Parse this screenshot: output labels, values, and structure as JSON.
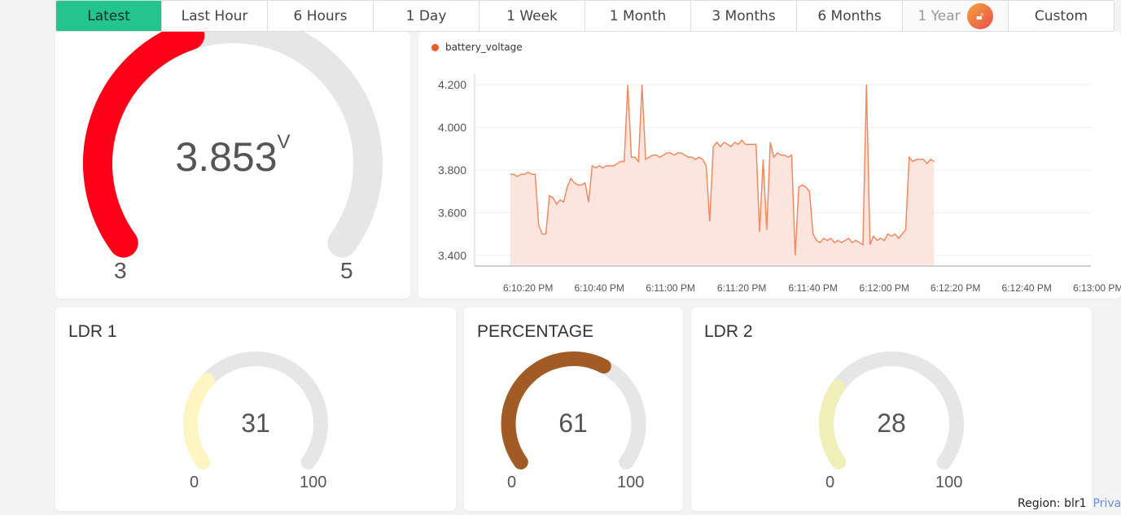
{
  "timebar": {
    "items": [
      {
        "label": "Latest",
        "active": true
      },
      {
        "label": "Last Hour"
      },
      {
        "label": "6 Hours"
      },
      {
        "label": "1 Day"
      },
      {
        "label": "1 Week"
      },
      {
        "label": "1 Month"
      },
      {
        "label": "3 Months"
      },
      {
        "label": "6 Months"
      },
      {
        "label": "1 Year",
        "locked": true,
        "icon": "lock-icon"
      },
      {
        "label": "Custom"
      }
    ]
  },
  "battery_gauge": {
    "value": "3.853",
    "unit": "V",
    "min": "3",
    "max": "5",
    "color": "#ff0019"
  },
  "chart_data": {
    "type": "area",
    "legend": "battery_voltage",
    "series_color": "#f28a5d",
    "fill_color": "#fde5df",
    "ylim": [
      3.35,
      4.25
    ],
    "yticks": [
      "4.200",
      "4.000",
      "3.800",
      "3.600",
      "3.400"
    ],
    "ytick_values": [
      4.2,
      4.0,
      3.8,
      3.6,
      3.4
    ],
    "xticks": [
      "6:10:20 PM",
      "6:10:40 PM",
      "6:11:00 PM",
      "6:11:20 PM",
      "6:11:40 PM",
      "6:12:00 PM",
      "6:12:20 PM",
      "6:12:40 PM",
      "6:13:00 PM"
    ],
    "x_seconds_start": 5,
    "x_seconds_end": 178,
    "points": [
      [
        15,
        3.78
      ],
      [
        16,
        3.78
      ],
      [
        17,
        3.77
      ],
      [
        18,
        3.78
      ],
      [
        19,
        3.78
      ],
      [
        20,
        3.79
      ],
      [
        21,
        3.78
      ],
      [
        22,
        3.78
      ],
      [
        23,
        3.54
      ],
      [
        24,
        3.5
      ],
      [
        25,
        3.5
      ],
      [
        26,
        3.68
      ],
      [
        27,
        3.67
      ],
      [
        28,
        3.64
      ],
      [
        29,
        3.66
      ],
      [
        30,
        3.65
      ],
      [
        31,
        3.72
      ],
      [
        32,
        3.76
      ],
      [
        33,
        3.74
      ],
      [
        34,
        3.73
      ],
      [
        35,
        3.73
      ],
      [
        36,
        3.74
      ],
      [
        37,
        3.65
      ],
      [
        38,
        3.82
      ],
      [
        39,
        3.81
      ],
      [
        40,
        3.82
      ],
      [
        41,
        3.81
      ],
      [
        42,
        3.82
      ],
      [
        43,
        3.82
      ],
      [
        44,
        3.82
      ],
      [
        45,
        3.83
      ],
      [
        46,
        3.84
      ],
      [
        47,
        3.84
      ],
      [
        48,
        4.2
      ],
      [
        49,
        3.86
      ],
      [
        50,
        3.86
      ],
      [
        51,
        3.84
      ],
      [
        52,
        4.2
      ],
      [
        53,
        3.85
      ],
      [
        54,
        3.86
      ],
      [
        55,
        3.87
      ],
      [
        56,
        3.87
      ],
      [
        57,
        3.86
      ],
      [
        58,
        3.87
      ],
      [
        59,
        3.88
      ],
      [
        60,
        3.88
      ],
      [
        61,
        3.87
      ],
      [
        62,
        3.88
      ],
      [
        63,
        3.88
      ],
      [
        64,
        3.87
      ],
      [
        65,
        3.86
      ],
      [
        66,
        3.86
      ],
      [
        67,
        3.85
      ],
      [
        68,
        3.86
      ],
      [
        69,
        3.85
      ],
      [
        70,
        3.82
      ],
      [
        71,
        3.56
      ],
      [
        72,
        3.91
      ],
      [
        73,
        3.93
      ],
      [
        74,
        3.91
      ],
      [
        75,
        3.93
      ],
      [
        76,
        3.92
      ],
      [
        77,
        3.91
      ],
      [
        78,
        3.93
      ],
      [
        79,
        3.92
      ],
      [
        80,
        3.94
      ],
      [
        81,
        3.92
      ],
      [
        82,
        3.92
      ],
      [
        83,
        3.92
      ],
      [
        84,
        3.92
      ],
      [
        85,
        3.51
      ],
      [
        86,
        3.85
      ],
      [
        87,
        3.52
      ],
      [
        88,
        3.93
      ],
      [
        89,
        3.86
      ],
      [
        90,
        3.88
      ],
      [
        91,
        3.87
      ],
      [
        92,
        3.87
      ],
      [
        93,
        3.86
      ],
      [
        94,
        3.87
      ],
      [
        95,
        3.4
      ],
      [
        96,
        3.72
      ],
      [
        97,
        3.73
      ],
      [
        98,
        3.72
      ],
      [
        99,
        3.7
      ],
      [
        100,
        3.5
      ],
      [
        101,
        3.47
      ],
      [
        102,
        3.46
      ],
      [
        103,
        3.48
      ],
      [
        104,
        3.47
      ],
      [
        105,
        3.48
      ],
      [
        106,
        3.46
      ],
      [
        107,
        3.47
      ],
      [
        108,
        3.46
      ],
      [
        109,
        3.47
      ],
      [
        110,
        3.48
      ],
      [
        111,
        3.46
      ],
      [
        112,
        3.47
      ],
      [
        113,
        3.46
      ],
      [
        114,
        3.45
      ],
      [
        115,
        4.2
      ],
      [
        116,
        3.45
      ],
      [
        117,
        3.49
      ],
      [
        118,
        3.47
      ],
      [
        119,
        3.48
      ],
      [
        120,
        3.47
      ],
      [
        121,
        3.5
      ],
      [
        122,
        3.49
      ],
      [
        123,
        3.5
      ],
      [
        124,
        3.48
      ],
      [
        125,
        3.5
      ],
      [
        126,
        3.52
      ],
      [
        127,
        3.86
      ],
      [
        128,
        3.84
      ],
      [
        129,
        3.85
      ],
      [
        130,
        3.85
      ],
      [
        131,
        3.85
      ],
      [
        132,
        3.83
      ],
      [
        133,
        3.85
      ],
      [
        134,
        3.84
      ]
    ]
  },
  "ldr1": {
    "title": "LDR 1",
    "value": "31",
    "fraction": 0.31,
    "min": "0",
    "max": "100",
    "color": "#fdf6c3"
  },
  "percentage": {
    "title": "PERCENTAGE",
    "value": "61",
    "fraction": 0.61,
    "min": "0",
    "max": "100",
    "color": "#a25b25"
  },
  "ldr2": {
    "title": "LDR 2",
    "value": "28",
    "fraction": 0.28,
    "min": "0",
    "max": "100",
    "color": "#f1eeb8"
  },
  "footer": {
    "region": "Region: blr1",
    "privacy": "Privacy"
  }
}
